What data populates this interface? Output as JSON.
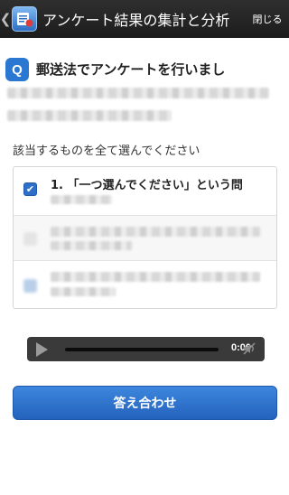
{
  "header": {
    "back_glyph": "❮",
    "title": "アンケート結果の集計と分析",
    "close_label": "閉じる"
  },
  "question": {
    "badge": "Q",
    "title": "郵送法でアンケートを行いまし",
    "instruction": "該当するものを全て選んでください"
  },
  "options": [
    {
      "label": "1. 「一つ選んでください」という問",
      "checked": true
    }
  ],
  "audio": {
    "time": "0:00"
  },
  "submit_label": "答え合わせ",
  "colors": {
    "accent": "#2b78d3",
    "topbar": "#262626",
    "player": "#3a3a3a"
  }
}
